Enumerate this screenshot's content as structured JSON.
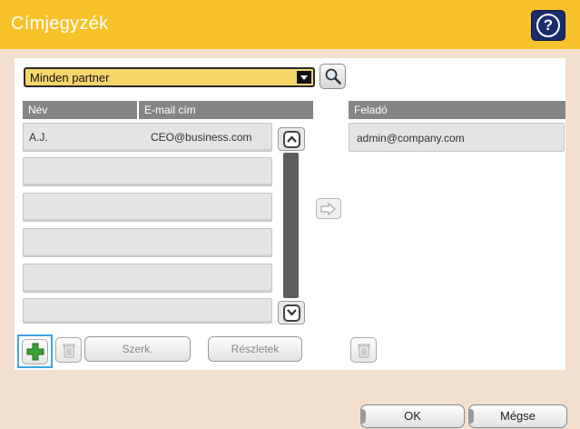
{
  "header": {
    "title": "Címjegyzék",
    "help_icon": "help-icon"
  },
  "filter": {
    "selected": "Minden partner",
    "search_icon": "search-icon"
  },
  "contacts_table": {
    "columns": [
      "Név",
      "E-mail cím"
    ],
    "rows": [
      {
        "name": "A.J.",
        "email": "CEO@business.com"
      },
      {
        "name": "",
        "email": ""
      },
      {
        "name": "",
        "email": ""
      },
      {
        "name": "",
        "email": ""
      },
      {
        "name": "",
        "email": ""
      },
      {
        "name": "",
        "email": ""
      }
    ]
  },
  "sender": {
    "header": "Feladó",
    "value": "admin@company.com"
  },
  "actions": {
    "edit_label": "Szerk.",
    "details_label": "Részletek"
  },
  "footer": {
    "ok_label": "OK",
    "cancel_label": "Mégse"
  },
  "colors": {
    "title_bar": "#f8c22b",
    "panel_bg": "#f3dfce",
    "dropdown_bg": "#f6d66b",
    "add_icon": "#3aa13a",
    "help_btn": "#1a2d6b"
  }
}
